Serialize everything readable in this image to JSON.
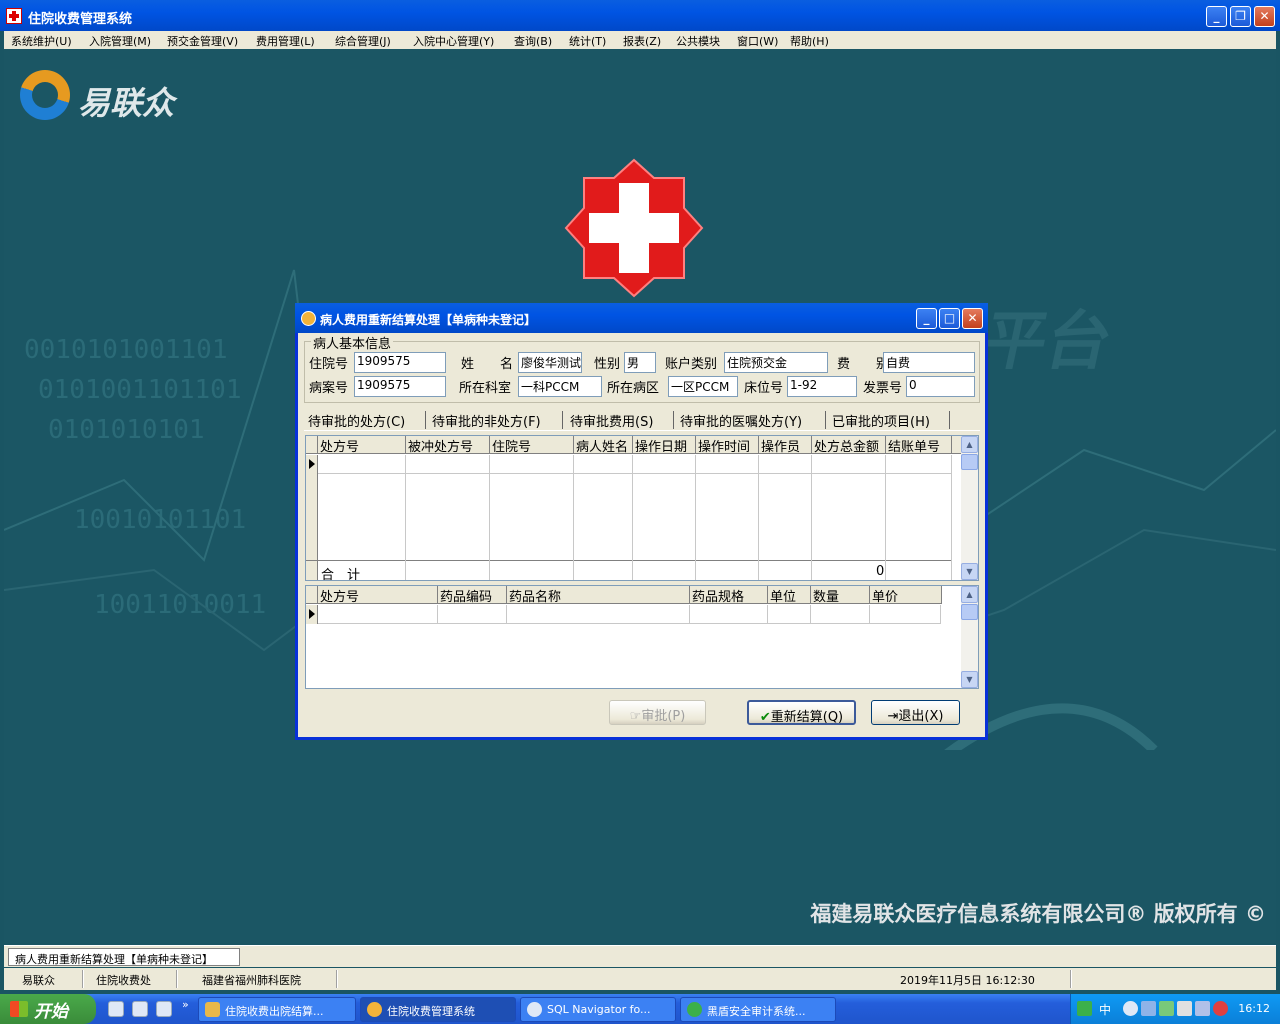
{
  "window": {
    "title": "住院收费管理系统"
  },
  "menu": [
    "系统维护(U)",
    "入院管理(M)",
    "预交金管理(V)",
    "费用管理(L)",
    "综合管理(J)",
    "入院中心管理(Y)",
    "查询(B)",
    "统计(T)",
    "报表(Z)",
    "公共模块",
    "窗口(W)",
    "帮助(H)"
  ],
  "background": {
    "logo_text": "易联众",
    "binary_lines": [
      "0010101001101",
      "0101001101101",
      "0101010101",
      "10010101101",
      "10011010011"
    ],
    "platform_text": "平台",
    "copyright": "福建易联众医疗信息系统有限公司® 版权所有 ©"
  },
  "dialog": {
    "title": "病人费用重新结算处理【单病种未登记】",
    "group_title": "病人基本信息",
    "fields": {
      "inpatient_no": {
        "label": "住院号",
        "value": "1909575"
      },
      "name": {
        "label": "姓　　名",
        "value": "廖俊华测试"
      },
      "gender": {
        "label": "性别",
        "value": "男"
      },
      "account_type": {
        "label": "账户类别",
        "value": "住院预交金"
      },
      "fee_type": {
        "label": "费　　别",
        "value": "自费"
      },
      "case_no": {
        "label": "病案号",
        "value": "1909575"
      },
      "department": {
        "label": "所在科室",
        "value": "一科PCCM"
      },
      "ward": {
        "label": "所在病区",
        "value": "一区PCCM"
      },
      "bed_no": {
        "label": "床位号",
        "value": "1-92"
      },
      "invoice_no": {
        "label": "发票号",
        "value": "0"
      }
    },
    "tabs": [
      "待审批的处方(C)",
      "待审批的非处方(F)",
      "待审批费用(S)",
      "待审批的医嘱处方(Y)",
      "已审批的项目(H)"
    ],
    "grid1": {
      "columns": [
        "处方号",
        "被冲处方号",
        "住院号",
        "病人姓名",
        "操作日期",
        "操作时间",
        "操作员",
        "处方总金额",
        "结账单号"
      ],
      "total_label": "合　计",
      "total_value": "0"
    },
    "grid2": {
      "columns": [
        "处方号",
        "药品编码",
        "药品名称",
        "药品规格",
        "单位",
        "数量",
        "单价"
      ]
    },
    "buttons": {
      "approve": "审批(P)",
      "resettle": "重新结算(Q)",
      "exit": "退出(X)"
    }
  },
  "mdi_tab": "病人费用重新结算处理【单病种未登记】",
  "status": {
    "company": "易联众",
    "office": "住院收费处",
    "hospital": "福建省福州肺科医院",
    "datetime": "2019年11月5日  16:12:30"
  },
  "taskbar": {
    "start": "开始",
    "items": [
      "住院收费出院结算...",
      "住院收费管理系统",
      "SQL Navigator fo...",
      "黑盾安全审计系统..."
    ],
    "tray_ime": "中",
    "clock": "16:12"
  }
}
